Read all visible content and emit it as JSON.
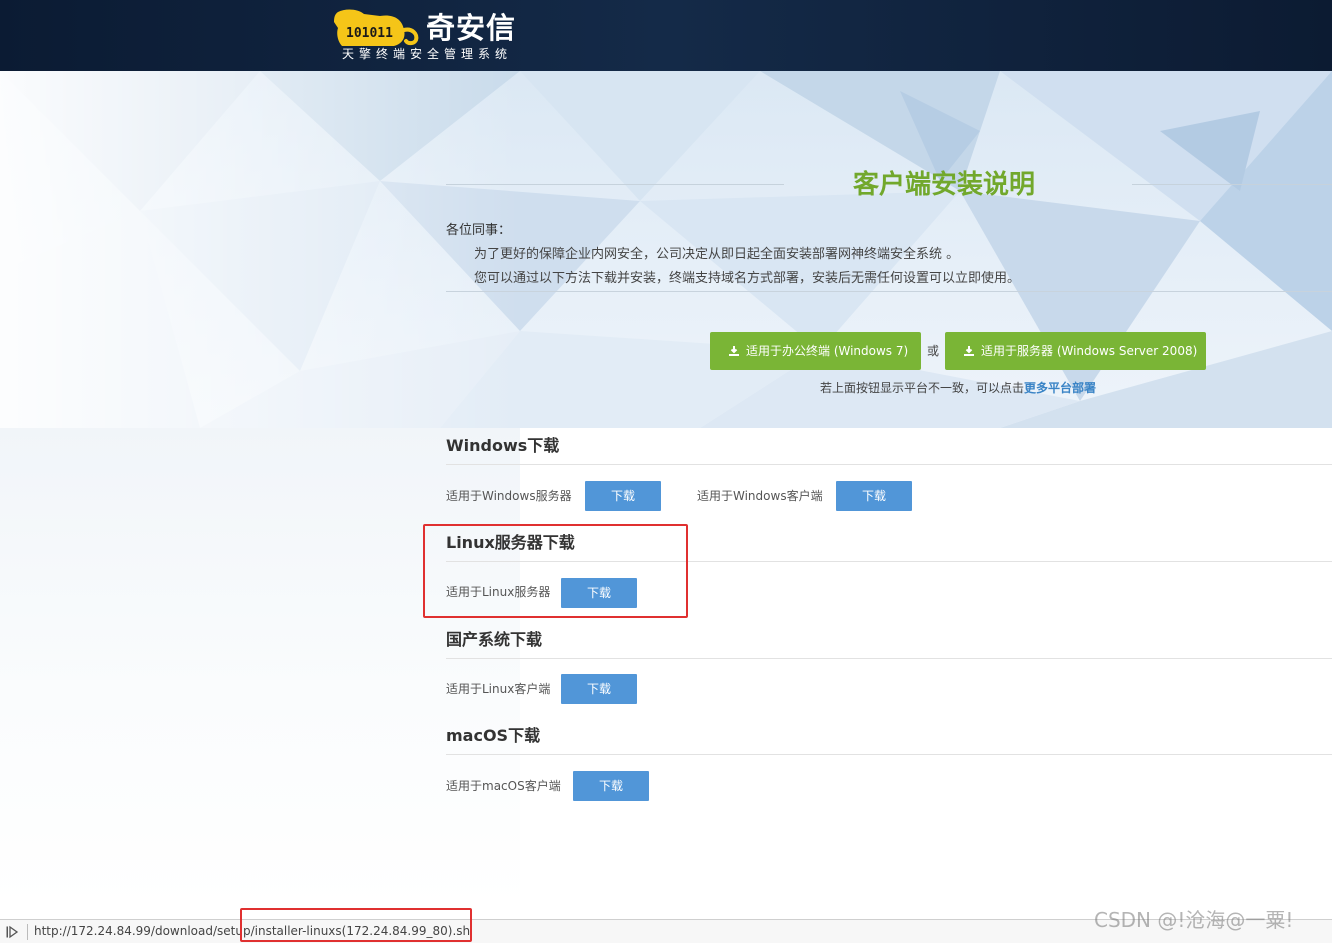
{
  "header": {
    "brand_name": "奇安信",
    "product_subtitle": "天擎终端安全管理系统",
    "logo_mark_text": "101011"
  },
  "hero": {
    "title": "客户端安装说明",
    "greeting": "各位同事：",
    "paragraph_1": "为了更好的保障企业内网安全，公司决定从即日起全面安装部署网神终端安全系统 。",
    "paragraph_2": "您可以通过以下方法下载并安装，终端支持域名方式部署，安装后无需任何设置可以立即使用。",
    "button_windows7": "适用于办公终端 (Windows 7)",
    "or_text": "或",
    "button_server2008": "适用于服务器 (Windows Server 2008)",
    "hint_text": "若上面按钮显示平台不一致，可以点击",
    "hint_link": "更多平台部署"
  },
  "sections": {
    "windows": {
      "title": "Windows下载",
      "server_label": "适用于Windows服务器",
      "server_button": "下载",
      "client_label": "适用于Windows客户端",
      "client_button": "下载"
    },
    "linux": {
      "title": "Linux服务器下载",
      "server_label": "适用于Linux服务器",
      "server_button": "下载"
    },
    "domestic": {
      "title": "国产系统下载",
      "client_label": "适用于Linux客户端",
      "client_button": "下载"
    },
    "macos": {
      "title": "macOS下载",
      "client_label": "适用于macOS客户端",
      "client_button": "下载"
    }
  },
  "statusbar": {
    "url": "http://172.24.84.99/download/setup/installer-linuxs(172.24.84.99_80).sh"
  },
  "watermark": "CSDN @!沧海@一粟!",
  "colors": {
    "header_bg": "#0b1b33",
    "title_green": "#72a82c",
    "green_button": "#7ab536",
    "blue_button": "#5196d8",
    "link_blue": "#3a84c6",
    "highlight_red": "#e03030",
    "logo_yellow": "#f5c518"
  },
  "icons": {
    "download": "download-icon",
    "status": "page-status-icon",
    "logo": "tiger-logo-icon"
  }
}
